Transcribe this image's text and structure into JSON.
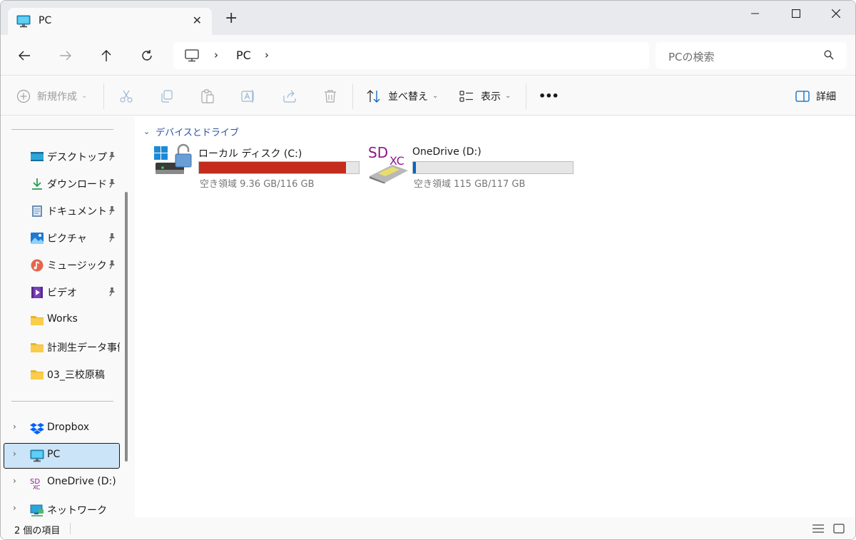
{
  "window": {
    "tab_title": "PC",
    "new_tab": "+"
  },
  "nav": {
    "breadcrumb": "PC",
    "search_placeholder": "PCの検索"
  },
  "commands": {
    "new": "新規作成",
    "sort": "並べ替え",
    "view": "表示",
    "more": "•••",
    "details": "詳細"
  },
  "sidebar": {
    "quick_access": [
      {
        "label": "デスクトップ",
        "icon": "desktop-icon",
        "pinned": true
      },
      {
        "label": "ダウンロード",
        "icon": "download-icon",
        "pinned": true
      },
      {
        "label": "ドキュメント",
        "icon": "document-icon",
        "pinned": true
      },
      {
        "label": "ピクチャ",
        "icon": "pictures-icon",
        "pinned": true
      },
      {
        "label": "ミュージック",
        "icon": "music-icon",
        "pinned": true
      },
      {
        "label": "ビデオ",
        "icon": "video-icon",
        "pinned": true
      },
      {
        "label": "Works",
        "icon": "folder-icon",
        "pinned": false
      },
      {
        "label": "計測生データ事例",
        "icon": "folder-icon",
        "pinned": false
      },
      {
        "label": "03_三校原稿",
        "icon": "folder-icon",
        "pinned": false
      }
    ],
    "locations": [
      {
        "label": "Dropbox",
        "icon": "dropbox-icon"
      },
      {
        "label": "PC",
        "icon": "pc-icon"
      },
      {
        "label": "OneDrive (D:)",
        "icon": "sdxc-icon"
      },
      {
        "label": "ネットワーク",
        "icon": "network-icon"
      }
    ]
  },
  "content": {
    "group_title": "デバイスとドライブ",
    "drives": [
      {
        "name": "ローカル ディスク (C:)",
        "free_text": "空き領域 9.36 GB/116 GB",
        "used_fraction": 0.919,
        "bar_color": "#c42b1c"
      },
      {
        "name": "OneDrive (D:)",
        "free_text": "空き領域 115 GB/117 GB",
        "used_fraction": 0.017,
        "bar_color": "#0067c0"
      }
    ]
  },
  "status": {
    "item_count": "2 個の項目"
  },
  "colors": {
    "accent": "#0067c0",
    "selected_bg": "#cce4f7",
    "group_header": "#2c4f9d"
  }
}
